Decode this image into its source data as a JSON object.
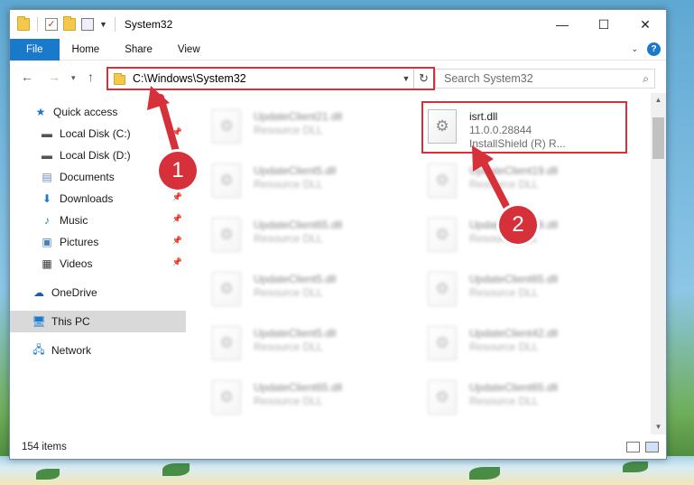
{
  "window": {
    "title": "System32",
    "controls": {
      "minimize": "—",
      "maximize": "☐",
      "close": "✕"
    }
  },
  "ribbon": {
    "tabs": [
      "File",
      "Home",
      "Share",
      "View"
    ],
    "help": "?"
  },
  "address": {
    "path": "C:\\Windows\\System32",
    "search_placeholder": "Search System32"
  },
  "nav": {
    "items": [
      {
        "label": "Quick access",
        "icon": "star-icon"
      },
      {
        "label": "Local Disk (C:)",
        "icon": "drive-icon",
        "pinned": true
      },
      {
        "label": "Local Disk (D:)",
        "icon": "drive-icon",
        "pinned": false
      },
      {
        "label": "Documents",
        "icon": "documents-icon",
        "pinned": true
      },
      {
        "label": "Downloads",
        "icon": "download-icon",
        "pinned": true
      },
      {
        "label": "Music",
        "icon": "music-icon",
        "pinned": true
      },
      {
        "label": "Pictures",
        "icon": "pictures-icon",
        "pinned": true
      },
      {
        "label": "Videos",
        "icon": "videos-icon",
        "pinned": true
      },
      {
        "label": "OneDrive",
        "icon": "cloud-icon"
      },
      {
        "label": "This PC",
        "icon": "computer-icon",
        "selected": true
      },
      {
        "label": "Network",
        "icon": "network-icon"
      }
    ]
  },
  "files": {
    "highlighted": {
      "name": "isrt.dll",
      "version": "11.0.0.28844",
      "company": "InstallShield (R) R..."
    },
    "left_column": [
      {
        "name": "UpdateClient21.dll",
        "type": "Resource DLL"
      },
      {
        "name": "UpdateClient5.dll",
        "type": "Resource DLL"
      },
      {
        "name": "UpdateClient65.dll",
        "type": "Resource DLL"
      },
      {
        "name": "UpdateClient5.dll",
        "type": "Resource DLL"
      },
      {
        "name": "UpdateClient5.dll",
        "type": "Resource DLL"
      },
      {
        "name": "UpdateClient65.dll",
        "type": "Resource DLL"
      }
    ],
    "right_column": [
      {
        "name": "UpdateClient19.dll",
        "type": "Resource DLL"
      },
      {
        "name": "UpdateClient19.dll",
        "type": "Resource DLL"
      },
      {
        "name": "UpdateClient65.dll",
        "type": "Resource DLL"
      },
      {
        "name": "UpdateClient42.dll",
        "type": "Resource DLL"
      },
      {
        "name": "UpdateClient65.dll",
        "type": "Resource DLL"
      }
    ]
  },
  "status": {
    "item_count": "154 items"
  },
  "annotations": {
    "marker1": "1",
    "marker2": "2",
    "accent": "#d6303a"
  }
}
